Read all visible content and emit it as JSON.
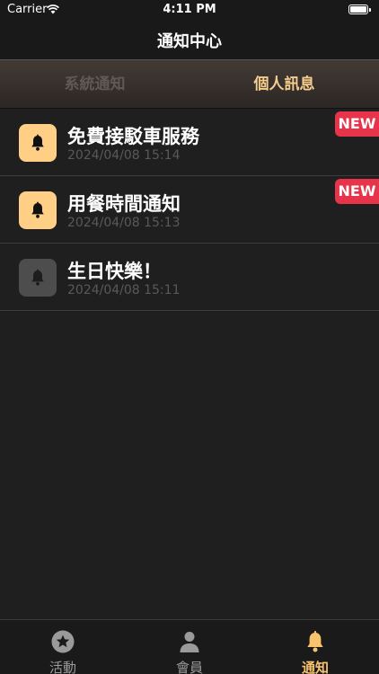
{
  "status_bar": {
    "carrier": "Carrier",
    "time": "4:11 PM"
  },
  "nav": {
    "title": "通知中心"
  },
  "segments": [
    {
      "label": "系統通知",
      "selected": false
    },
    {
      "label": "個人訊息",
      "selected": true
    }
  ],
  "notifications": [
    {
      "title": "免費接駁車服務",
      "time": "2024/04/08 15:14",
      "badge": "NEW",
      "unread": true
    },
    {
      "title": "用餐時間通知",
      "time": "2024/04/08 15:13",
      "badge": "NEW",
      "unread": true
    },
    {
      "title": "生日快樂！",
      "time": "2024/04/08 15:11",
      "badge": "",
      "unread": false
    }
  ],
  "tabs": [
    {
      "label": "活動",
      "icon": "star-circle-icon",
      "active": false
    },
    {
      "label": "會員",
      "icon": "person-icon",
      "active": false
    },
    {
      "label": "通知",
      "icon": "bell-icon",
      "active": true
    }
  ],
  "colors": {
    "accent": "#f5cd8d",
    "badge": "#e8344a",
    "unread_icon_bg": "#ffcf85",
    "read_icon_bg": "#4d4d4d",
    "background": "#1f1f1f"
  }
}
